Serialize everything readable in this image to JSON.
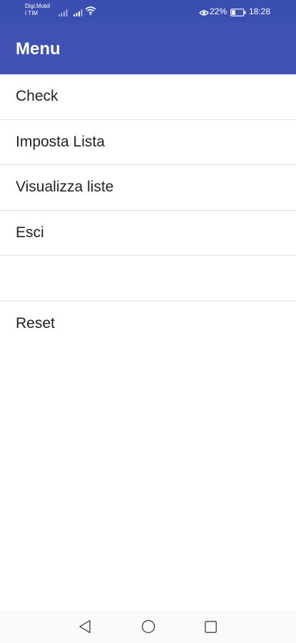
{
  "status_bar": {
    "carrier": "Digi.Mobil\nI TIM",
    "battery_percent": "22%",
    "time": "18:28",
    "icons": [
      "signal-icon",
      "signal-icon",
      "wifi-icon",
      "eye-icon",
      "battery-icon"
    ]
  },
  "app_bar": {
    "title": "Menu",
    "color": "#3f51b5"
  },
  "menu": {
    "items": [
      {
        "label": "Check"
      },
      {
        "label": "Imposta Lista"
      },
      {
        "label": "Visualizza liste"
      },
      {
        "label": "Esci"
      },
      {
        "label": ""
      },
      {
        "label": "Reset"
      }
    ]
  },
  "nav_bar": {
    "icons": [
      "back-icon",
      "home-icon",
      "recent-apps-icon"
    ]
  }
}
